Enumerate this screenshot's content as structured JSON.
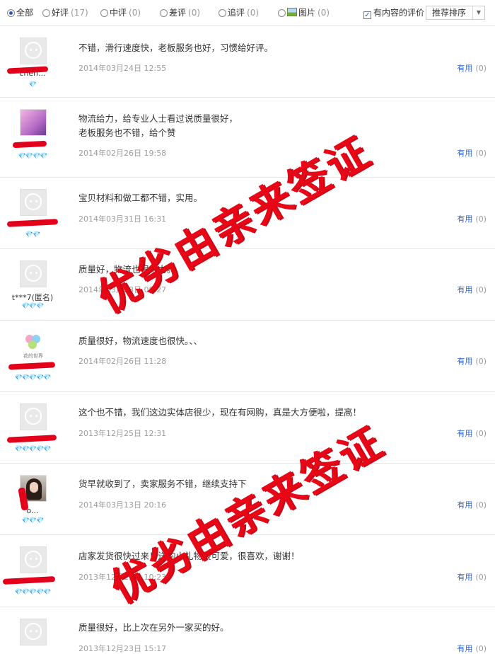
{
  "filters": {
    "all": {
      "label": "全部"
    },
    "good": {
      "label": "好评",
      "count": "(17)"
    },
    "neutral": {
      "label": "中评",
      "count": "(0)"
    },
    "bad": {
      "label": "差评",
      "count": "(0)"
    },
    "followup": {
      "label": "追评",
      "count": "(0)"
    },
    "pictures": {
      "label": "图片",
      "count": "(0)"
    },
    "with_content": {
      "label": "有内容的评价",
      "checked": true
    },
    "sort": {
      "selected": "推荐排序"
    }
  },
  "reviews": [
    {
      "user": "chen...",
      "hearts": "💎",
      "content": "不错，滑行速度快，老板服务也好，习惯给好评。",
      "date": "2014年03月24日 12:55",
      "useful_label": "有用",
      "useful_count": "(0)"
    },
    {
      "user": "",
      "hearts": "💎💎💎💎",
      "content": "物流给力，给专业人士看过说质量很好，\n老板服务也不错，给个赞",
      "date": "2014年02月26日 19:58",
      "useful_label": "有用",
      "useful_count": "(0)"
    },
    {
      "user": "",
      "hearts": "💎💎",
      "content": "宝贝材料和做工都不错，实用。",
      "date": "2014年03月31日 16:31",
      "useful_label": "有用",
      "useful_count": "(0)"
    },
    {
      "user": "t***7(匿名)",
      "hearts": "💎💎💎",
      "content": "质量好，物流也很给力。",
      "date": "2014年03月28日 08:27",
      "useful_label": "有用",
      "useful_count": "(0)"
    },
    {
      "user": "",
      "hearts": "💎💎💎💎💎",
      "content": "质量很好，物流速度也很快。、、",
      "date": "2014年02月26日 11:28",
      "useful_label": "有用",
      "useful_count": "(0)",
      "avatar_caption": "花的世界"
    },
    {
      "user": "",
      "hearts": "💎💎💎💎💎",
      "content": "这个也不错，我们这边实体店很少，现在有网购，真是大方便啦，提高！",
      "date": "2013年12月25日 12:31",
      "useful_label": "有用",
      "useful_count": "(0)"
    },
    {
      "user": "o...",
      "hearts": "💎💎💎",
      "content": "货早就收到了，卖家服务不错，继续支持下",
      "date": "2014年03月13日 20:16",
      "useful_label": "有用",
      "useful_count": "(0)"
    },
    {
      "user": "",
      "hearts": "💎💎💎💎💎",
      "content": "店家发货很快过来！送的小礼物很可爱，很喜欢，谢谢！",
      "date": "2013年12月25日 10:23",
      "useful_label": "有用",
      "useful_count": "(0)"
    },
    {
      "user": "",
      "hearts": "",
      "content": "质量很好，比上次在另外一家买的好。",
      "date": "2013年12月23日 15:17",
      "useful_label": "有用",
      "useful_count": "(0)"
    }
  ],
  "watermark": {
    "line1": "优劣由亲来签证",
    "line2": "优劣由亲来签证"
  },
  "colors": {
    "link": "#3366cc",
    "watermark": "#e8000f",
    "muted": "#9c9c9c"
  }
}
